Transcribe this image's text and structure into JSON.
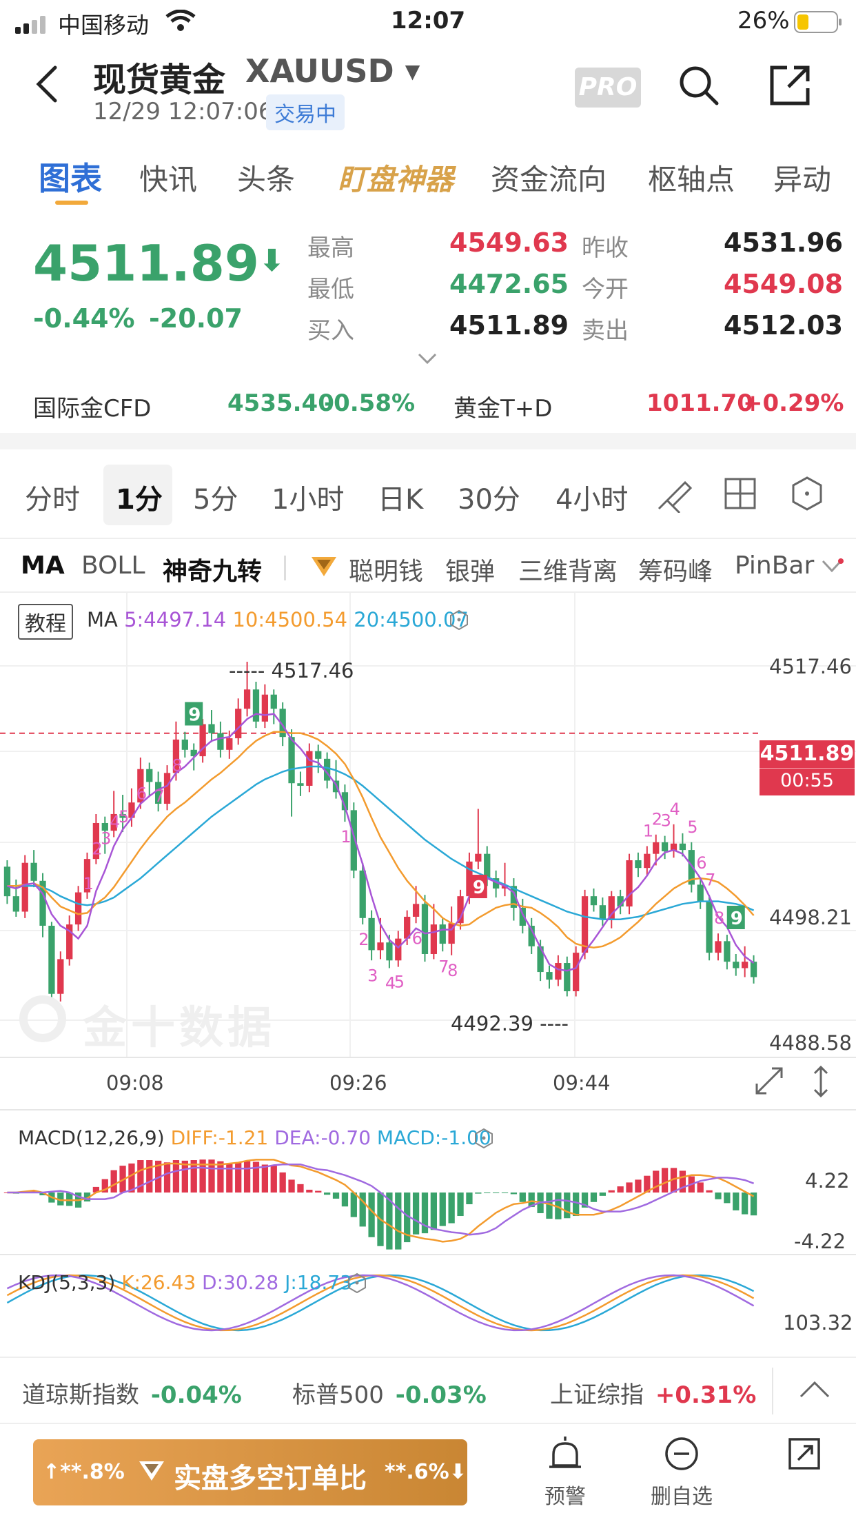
{
  "status_bar": {
    "carrier": "中国移动",
    "time": "12:07",
    "battery": "26%"
  },
  "header": {
    "title": "现货黄金",
    "symbol": "XAUUSD",
    "datetime": "12/29 12:07:06",
    "status_badge": "交易中",
    "pro_label": "PRO"
  },
  "tabs": [
    "图表",
    "快讯",
    "头条",
    "盯盘神器",
    "资金流向",
    "枢轴点",
    "异动"
  ],
  "quote": {
    "price": "4511.89",
    "change_pct": "-0.44%",
    "change_abs": "-20.07",
    "high_label": "最高",
    "high": "4549.63",
    "low_label": "最低",
    "low": "4472.65",
    "bid_label": "买入",
    "bid": "4511.89",
    "prev_close_label": "昨收",
    "prev_close": "4531.96",
    "open_label": "今开",
    "open": "4549.08",
    "ask_label": "卖出",
    "ask": "4512.03"
  },
  "reference": {
    "cfd_label": "国际金CFD",
    "cfd_price": "4535.40",
    "cfd_change": "-0.58%",
    "td_label": "黄金T+D",
    "td_price": "1011.70",
    "td_change": "+0.29%"
  },
  "periods": [
    "分时",
    "1分",
    "5分",
    "1小时",
    "日K",
    "30分",
    "4小时"
  ],
  "active_period": "1分",
  "indicators": [
    "MA",
    "BOLL",
    "神奇九转",
    "聪明钱",
    "银弹",
    "三维背离",
    "筹码峰",
    "PinBar"
  ],
  "chart": {
    "tutorial_label": "教程",
    "ma_label": "MA",
    "ma5": "5:4497.14",
    "ma10": "10:4500.54",
    "ma20": "20:4500.07",
    "y_labels": [
      "4517.46",
      "4498.21",
      "4488.58"
    ],
    "high_marker": "4517.46",
    "low_marker": "4492.39",
    "current_price": "4511.89",
    "countdown": "00:55",
    "time_labels": [
      "09:08",
      "09:26",
      "09:44"
    ],
    "watermark": "金十数据",
    "colors": {
      "up": "#e0384e",
      "down": "#3aa26b",
      "ma5": "#a855d6",
      "ma10": "#f39b2e",
      "ma20": "#2aa8d6",
      "nine": "#e05fc4"
    }
  },
  "chart_data": {
    "type": "candlestick",
    "ylim": [
      4488.58,
      4517.46
    ],
    "candles": [
      [
        4501.5,
        4499.2,
        4502.0,
        4498.6
      ],
      [
        4499.2,
        4498.0,
        4500.5,
        4497.6
      ],
      [
        4498.0,
        4501.8,
        4502.4,
        4497.5
      ],
      [
        4501.8,
        4500.4,
        4502.8,
        4499.9
      ],
      [
        4500.4,
        4496.9,
        4501.0,
        4496.0
      ],
      [
        4496.9,
        4491.6,
        4497.2,
        4490.8
      ],
      [
        4491.6,
        4494.3,
        4494.9,
        4491.0
      ],
      [
        4494.3,
        4497.0,
        4497.7,
        4493.8
      ],
      [
        4497.0,
        4499.5,
        4500.0,
        4496.5
      ],
      [
        4499.5,
        4502.1,
        4502.6,
        4499.0
      ],
      [
        4502.1,
        4504.9,
        4505.6,
        4501.7
      ],
      [
        4504.9,
        4504.3,
        4505.4,
        4502.5
      ],
      [
        4504.3,
        4505.6,
        4507.4,
        4503.8
      ],
      [
        4505.6,
        4505.3,
        4507.1,
        4504.2
      ],
      [
        4505.3,
        4506.5,
        4507.6,
        4504.6
      ],
      [
        4506.5,
        4509.1,
        4510.0,
        4506.0
      ],
      [
        4509.1,
        4508.1,
        4509.6,
        4507.0
      ],
      [
        4508.1,
        4506.4,
        4508.9,
        4505.8
      ],
      [
        4506.4,
        4508.8,
        4509.4,
        4505.9
      ],
      [
        4508.8,
        4511.4,
        4512.8,
        4508.2
      ],
      [
        4511.4,
        4510.6,
        4512.0,
        4510.0
      ],
      [
        4510.6,
        4510.1,
        4511.1,
        4509.0
      ],
      [
        4510.1,
        4512.6,
        4513.0,
        4509.6
      ],
      [
        4512.6,
        4511.9,
        4513.7,
        4511.2
      ],
      [
        4511.9,
        4510.6,
        4512.8,
        4510.0
      ],
      [
        4510.6,
        4511.5,
        4512.1,
        4509.9
      ],
      [
        4511.5,
        4513.8,
        4514.6,
        4511.0
      ],
      [
        4513.8,
        4515.3,
        4517.46,
        4513.2
      ],
      [
        4515.3,
        4512.8,
        4515.9,
        4512.3
      ],
      [
        4512.8,
        4514.9,
        4515.7,
        4512.3
      ],
      [
        4514.9,
        4513.8,
        4515.3,
        4512.6
      ],
      [
        4513.8,
        4511.6,
        4514.3,
        4510.9
      ],
      [
        4511.6,
        4508.0,
        4512.2,
        4505.4
      ],
      [
        4508.0,
        4507.8,
        4508.9,
        4507.0
      ],
      [
        4507.8,
        4510.5,
        4511.1,
        4507.3
      ],
      [
        4510.5,
        4509.9,
        4511.0,
        4508.8
      ],
      [
        4509.9,
        4508.2,
        4510.4,
        4507.6
      ],
      [
        4508.2,
        4507.3,
        4509.8,
        4506.8
      ],
      [
        4507.3,
        4505.9,
        4507.9,
        4505.0
      ],
      [
        4505.9,
        4501.2,
        4506.5,
        4500.6
      ],
      [
        4501.2,
        4497.5,
        4501.8,
        4497.0
      ],
      [
        4497.5,
        4495.0,
        4498.1,
        4494.2
      ],
      [
        4495.0,
        4495.6,
        4497.5,
        4494.3
      ],
      [
        4495.6,
        4494.2,
        4496.2,
        4493.6
      ],
      [
        4494.2,
        4495.9,
        4496.5,
        4493.7
      ],
      [
        4495.9,
        4497.6,
        4498.1,
        4495.4
      ],
      [
        4497.6,
        4498.6,
        4500.0,
        4497.1
      ],
      [
        4498.6,
        4494.7,
        4499.3,
        4494.1
      ],
      [
        4494.7,
        4497.0,
        4498.6,
        4494.3
      ],
      [
        4497.0,
        4495.5,
        4497.5,
        4494.9
      ],
      [
        4495.5,
        4497.1,
        4498.4,
        4494.6
      ],
      [
        4497.1,
        4499.2,
        4499.7,
        4496.6
      ],
      [
        4499.2,
        4501.9,
        4502.6,
        4498.6
      ],
      [
        4501.9,
        4502.5,
        4506.0,
        4501.3
      ],
      [
        4502.5,
        4500.6,
        4503.1,
        4500.0
      ],
      [
        4500.6,
        4499.8,
        4501.2,
        4499.1
      ],
      [
        4499.8,
        4500.0,
        4501.8,
        4499.2
      ],
      [
        4500.0,
        4498.3,
        4500.6,
        4497.3
      ],
      [
        4498.3,
        4496.9,
        4499.0,
        4496.3
      ],
      [
        4496.9,
        4495.3,
        4497.5,
        4494.7
      ],
      [
        4495.3,
        4493.3,
        4495.8,
        4492.6
      ],
      [
        4493.3,
        4492.7,
        4493.8,
        4492.0
      ],
      [
        4492.7,
        4494.0,
        4494.6,
        4492.2
      ],
      [
        4494.0,
        4491.8,
        4494.5,
        4491.4
      ],
      [
        4491.8,
        4494.8,
        4495.3,
        4491.4
      ],
      [
        4494.8,
        4499.2,
        4499.7,
        4494.3
      ],
      [
        4499.2,
        4498.5,
        4499.8,
        4498.0
      ],
      [
        4498.5,
        4497.4,
        4499.1,
        4496.9
      ],
      [
        4497.4,
        4499.2,
        4499.6,
        4496.7
      ],
      [
        4499.2,
        4498.4,
        4499.7,
        4497.8
      ],
      [
        4498.4,
        4502.0,
        4502.5,
        4497.8
      ],
      [
        4502.0,
        4501.4,
        4502.6,
        4500.7
      ],
      [
        4501.4,
        4502.5,
        4503.1,
        4500.8
      ],
      [
        4502.5,
        4503.4,
        4504.0,
        4501.6
      ],
      [
        4503.4,
        4502.7,
        4503.9,
        4502.1
      ],
      [
        4502.7,
        4503.3,
        4504.8,
        4502.2
      ],
      [
        4503.3,
        4502.8,
        4504.1,
        4502.3
      ],
      [
        4502.8,
        4500.1,
        4503.4,
        4499.5
      ],
      [
        4500.1,
        4498.8,
        4500.6,
        4498.2
      ],
      [
        4498.8,
        4494.8,
        4499.3,
        4494.2
      ],
      [
        4494.8,
        4495.7,
        4496.3,
        4494.2
      ],
      [
        4495.7,
        4494.1,
        4496.2,
        4493.5
      ],
      [
        4494.1,
        4493.6,
        4494.7,
        4493.0
      ],
      [
        4493.6,
        4494.1,
        4495.3,
        4492.9
      ],
      [
        4494.1,
        4492.9,
        4494.6,
        4492.4
      ]
    ],
    "ma5_series": [
      4500.0,
      4499.8,
      4500.1,
      4500.2,
      4499.4,
      4497.8,
      4496.9,
      4496.5,
      4495.9,
      4496.9,
      4499.6,
      4501.2,
      4503.1,
      4504.4,
      4505.3,
      4506.4,
      4507.0,
      4507.5,
      4507.8,
      4508.8,
      4509.3,
      4510.0,
      4510.7,
      4511.3,
      4511.5,
      4511.6,
      4512.3,
      4513.0,
      4513.4,
      4513.3,
      4513.4,
      4512.5,
      4511.4,
      4510.7,
      4509.8,
      4509.6,
      4508.8,
      4507.9,
      4506.2,
      4503.9,
      4501.7,
      4499.2,
      4497.0,
      4495.8,
      4495.2,
      4495.9,
      4496.7,
      4496.3,
      4496.4,
      4496.6,
      4496.6,
      4497.5,
      4499.2,
      4500.8,
      4500.6,
      4500.3,
      4500.0,
      4499.5,
      4497.8,
      4496.6,
      4495.2,
      4493.9,
      4493.5,
      4493.4,
      4493.6,
      4494.9,
      4495.8,
      4496.8,
      4497.8,
      4498.5,
      4499.3,
      4499.9,
      4500.8,
      4501.9,
      4502.6,
      4502.8,
      4502.5,
      4501.6,
      4500.6,
      4499.2,
      4497.6,
      4496.8,
      4495.4,
      4494.5,
      4494.0
    ],
    "ma10_series": [
      4500.0,
      4500.0,
      4500.1,
      4500.2,
      4499.9,
      4499.1,
      4498.4,
      4498.1,
      4497.8,
      4497.9,
      4498.6,
      4499.1,
      4499.9,
      4500.9,
      4501.9,
      4502.9,
      4503.8,
      4504.6,
      4505.4,
      4506.0,
      4506.5,
      4507.1,
      4507.7,
      4508.3,
      4508.8,
      4509.4,
      4510.0,
      4510.7,
      4511.3,
      4511.7,
      4512.0,
      4512.0,
      4511.9,
      4511.9,
      4511.7,
      4511.4,
      4510.9,
      4510.3,
      4509.5,
      4508.3,
      4506.9,
      4505.3,
      4503.8,
      4502.6,
      4501.4,
      4500.4,
      4499.6,
      4498.8,
      4498.2,
      4497.5,
      4497.1,
      4496.9,
      4497.0,
      4497.5,
      4497.9,
      4498.3,
      4498.5,
      4498.6,
      4498.4,
      4498.3,
      4497.9,
      4497.4,
      4496.8,
      4496.0,
      4495.5,
      4495.3,
      4495.2,
      4495.3,
      4495.6,
      4496.0,
      4496.6,
      4497.2,
      4497.9,
      4498.6,
      4499.2,
      4499.8,
      4500.2,
      4500.5,
      4500.6,
      4500.5,
      4500.3,
      4499.8,
      4499.2,
      4498.5,
      4497.7
    ],
    "ma20_series": [
      4500.0,
      4500.0,
      4500.0,
      4500.0,
      4499.9,
      4499.6,
      4499.2,
      4498.9,
      4498.6,
      4498.5,
      4498.6,
      4498.8,
      4499.1,
      4499.6,
      4500.1,
      4500.6,
      4501.2,
      4501.8,
      4502.4,
      4503.0,
      4503.6,
      4504.2,
      4504.8,
      4505.4,
      4505.9,
      4506.4,
      4506.9,
      4507.4,
      4507.9,
      4508.3,
      4508.6,
      4508.9,
      4509.1,
      4509.2,
      4509.3,
      4509.3,
      4509.2,
      4509.0,
      4508.7,
      4508.3,
      4507.8,
      4507.2,
      4506.6,
      4506.0,
      4505.4,
      4504.8,
      4504.2,
      4503.6,
      4503.1,
      4502.6,
      4502.1,
      4501.7,
      4501.3,
      4501.0,
      4500.7,
      4500.4,
      4500.1,
      4499.8,
      4499.5,
      4499.2,
      4498.9,
      4498.6,
      4498.3,
      4498.0,
      4497.8,
      4497.6,
      4497.5,
      4497.4,
      4497.4,
      4497.4,
      4497.5,
      4497.6,
      4497.8,
      4498.0,
      4498.2,
      4498.4,
      4498.6,
      4498.7,
      4498.8,
      4498.8,
      4498.8,
      4498.7,
      4498.6,
      4498.4,
      4498.1
    ],
    "x_ticks": [
      "09:08",
      "09:26",
      "09:44"
    ]
  },
  "macd": {
    "title": "MACD(12,26,9)",
    "diff": "DIFF:-1.21",
    "dea": "DEA:-0.70",
    "macd": "MACD:-1.00",
    "y_top": "4.22",
    "y_bottom": "-4.22"
  },
  "kdj": {
    "title": "KDJ(5,3,3)",
    "k": "K:26.43",
    "d": "D:30.28",
    "j": "J:18.73",
    "y_top": "103.32"
  },
  "index_bar": [
    {
      "name": "道琼斯指数",
      "value": "-0.04%"
    },
    {
      "name": "标普500",
      "value": "-0.03%"
    },
    {
      "name": "上证综指",
      "value": "+0.31%"
    }
  ],
  "action_bar": {
    "left_pct": "**.8%",
    "title": "实盘多空订单比",
    "right_pct": "**.6%",
    "alert_label": "预警",
    "remove_label": "删自选"
  }
}
